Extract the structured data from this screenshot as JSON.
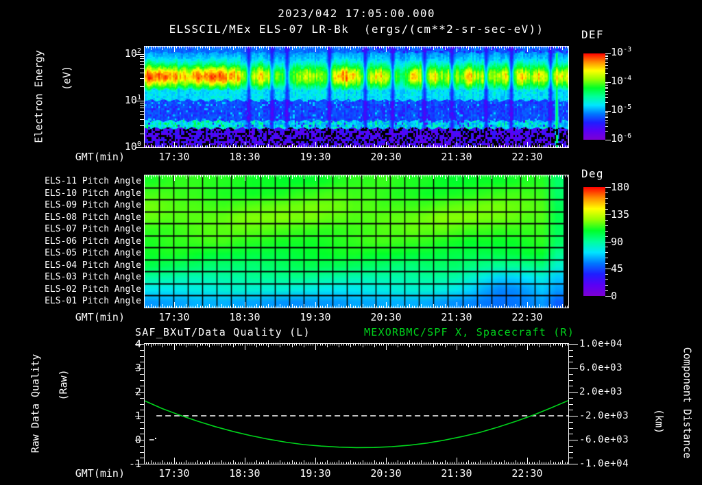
{
  "colors": {
    "background": "#000000",
    "foreground": "#ffffff",
    "series_green": "#00d41c",
    "colormap_stops_bottom_to_top": [
      "#7d00d2",
      "#5a00f5",
      "#1e1eff",
      "#0078ff",
      "#00e6ff",
      "#00ff9b",
      "#00ff28",
      "#96ff00",
      "#ffff00",
      "#ff8c00",
      "#ff0000"
    ]
  },
  "header": {
    "title": "2023/042 17:05:00.000",
    "subtitle": "ELSSCIL/MEx ELS-07 LR-Bk  (ergs/(cm**2-sr-sec-eV))"
  },
  "time_axis": {
    "label": "GMT(min)",
    "start_time": "17:05",
    "end_time": "23:05",
    "total_minutes": 360,
    "tick_labels": [
      "17:30",
      "18:30",
      "19:30",
      "20:30",
      "21:30",
      "22:30"
    ],
    "tick_minutes": [
      25,
      85,
      145,
      205,
      265,
      325
    ]
  },
  "spectrogram_panel": {
    "ylabel_line1": "Electron Energy",
    "ylabel_line2": "(eV)",
    "y_ticks": [
      {
        "base": "10",
        "exp": "0"
      },
      {
        "base": "10",
        "exp": "1"
      },
      {
        "base": "10",
        "exp": "2"
      }
    ],
    "colorbar": {
      "title": "DEF",
      "tick_labels": [
        {
          "base": "10",
          "exp": "-3"
        },
        {
          "base": "10",
          "exp": "-4"
        },
        {
          "base": "10",
          "exp": "-5"
        },
        {
          "base": "10",
          "exp": "-6"
        }
      ]
    }
  },
  "pitch_panel": {
    "row_labels": [
      "ELS-11 Pitch Angle",
      "ELS-10 Pitch Angle",
      "ELS-09 Pitch Angle",
      "ELS-08 Pitch Angle",
      "ELS-07 Pitch Angle",
      "ELS-06 Pitch Angle",
      "ELS-05 Pitch Angle",
      "ELS-04 Pitch Angle",
      "ELS-03 Pitch Angle",
      "ELS-02 Pitch Angle",
      "ELS-01 Pitch Angle"
    ],
    "colorbar": {
      "title": "Deg",
      "tick_labels": [
        "180",
        "135",
        "90",
        "45",
        "0"
      ]
    }
  },
  "bottom_panel": {
    "left_title": "SAF_BXuT/Data Quality (L)",
    "right_title": "MEXORBMC/SPF X, Spacecraft (R)",
    "left_axis": {
      "label_line1": "Raw Data Quality",
      "label_line2": "(Raw)",
      "tick_labels": [
        "4",
        "3",
        "2",
        "1",
        "0",
        "-1"
      ]
    },
    "right_axis": {
      "label_line1": "Component Distance",
      "label_line2": "(km)",
      "tick_labels": [
        "1.0e+04",
        "6.0e+03",
        "2.0e+03",
        "-2.0e+03",
        "-6.0e+03",
        "-1.0e+04"
      ]
    }
  },
  "chart_data": [
    {
      "type": "heatmap",
      "name": "electron-energy-spectrogram",
      "title": "ELSSCIL/MEx ELS-07 LR-Bk",
      "units": "ergs/(cm**2-sr-sec-eV)",
      "x_range": [
        "17:05",
        "23:05"
      ],
      "x_tick_labels": [
        "17:30",
        "18:30",
        "19:30",
        "20:30",
        "21:30",
        "22:30"
      ],
      "y_scale": "log",
      "y_range_ev": [
        1,
        145
      ],
      "y_tick_labels": [
        "10^0",
        "10^1",
        "10^2"
      ],
      "colorbar_title": "DEF",
      "color_scale_log10_range": [
        -6,
        -3
      ],
      "colorbar_tick_labels": [
        "10^-3",
        "10^-4",
        "10^-5",
        "10^-6"
      ],
      "energy_bands": [
        {
          "energy_ev": [
            1,
            2.5
          ],
          "log10_def": -5.8,
          "desc": "noise floor, dark violet with black speckle"
        },
        {
          "energy_ev": [
            2.5,
            3.6
          ],
          "log10_def": -4.7,
          "desc": "streaky cyan band, brighter before 18:30"
        },
        {
          "energy_ev": [
            3.6,
            10
          ],
          "log10_def": -5.2,
          "desc": "blue band with dark patches"
        },
        {
          "energy_ev": [
            10,
            17
          ],
          "log10_def": -4.65,
          "desc": "cyan transition band"
        },
        {
          "energy_ev": [
            17,
            60
          ],
          "log10_def": -3.5,
          "desc": "bright photoelectron band: yellow-green before 18:30, broken 18:30-20:30, striped green 20:30-22:40"
        },
        {
          "energy_ev": [
            60,
            105
          ],
          "log10_def": -4.4,
          "desc": "green-cyan shoulder"
        },
        {
          "energy_ev": [
            105,
            145
          ],
          "log10_def": -5.1,
          "desc": "blue top band, darker after 19:40"
        }
      ],
      "features": {
        "dropout_time_fracs": [
          0.245,
          0.3,
          0.335,
          0.435,
          0.52,
          0.585,
          0.66,
          0.725,
          0.805,
          0.865,
          0.958
        ],
        "bright_streak_frac": 0.972
      }
    },
    {
      "type": "heatmap",
      "name": "pitch-angle-panel",
      "deg_range": [
        0,
        180
      ],
      "colorbar_title": "Deg",
      "colorbar_tick_labels": [
        180,
        135,
        90,
        45,
        0
      ],
      "n_time_columns": 29,
      "rows": [
        {
          "label": "ELS-11 Pitch Angle",
          "mean_deg": 118
        },
        {
          "label": "ELS-10 Pitch Angle",
          "mean_deg": 120
        },
        {
          "label": "ELS-09 Pitch Angle",
          "mean_deg": 126
        },
        {
          "label": "ELS-08 Pitch Angle",
          "mean_deg": 128
        },
        {
          "label": "ELS-07 Pitch Angle",
          "mean_deg": 124
        },
        {
          "label": "ELS-06 Pitch Angle",
          "mean_deg": 120
        },
        {
          "label": "ELS-05 Pitch Angle",
          "mean_deg": 114
        },
        {
          "label": "ELS-04 Pitch Angle",
          "mean_deg": 106
        },
        {
          "label": "ELS-03 Pitch Angle",
          "mean_deg": 96
        },
        {
          "label": "ELS-02 Pitch Angle",
          "mean_deg": 84
        },
        {
          "label": "ELS-01 Pitch Angle",
          "mean_deg": 66
        }
      ],
      "anomaly": {
        "time": "21:15-22:05",
        "center_col": 24.4,
        "row_depth_deg": [
          0,
          0,
          0,
          0,
          0,
          -2,
          -5,
          -12,
          -22,
          -22,
          -8
        ]
      },
      "right_edge_deg_shift": -16
    },
    {
      "type": "line",
      "name": "quality-and-spacecraft-x",
      "left_ylim": [
        -1,
        4
      ],
      "right_ylim": [
        -10000,
        10000
      ],
      "left_tick_values": [
        4,
        3,
        2,
        1,
        0,
        -1
      ],
      "right_tick_values": [
        10000,
        6000,
        2000,
        -2000,
        -6000,
        -10000
      ],
      "series": [
        {
          "name": "SAF_BXuT/Data Quality (L)",
          "axis": "left",
          "color": "#ffffff",
          "style": "dashed",
          "segments_min_value": [
            [
              [
                4,
                0
              ],
              [
                8,
                0
              ]
            ],
            [
              [
                10,
                1
              ],
              [
                360,
                1
              ]
            ]
          ]
        },
        {
          "name": "MEXORBMC/SPF X, Spacecraft (R)",
          "axis": "right",
          "color": "#00d41c",
          "style": "solid",
          "points_min_km": [
            [
              0,
              500
            ],
            [
              15,
              -800
            ],
            [
              30,
              -1900
            ],
            [
              45,
              -2900
            ],
            [
              60,
              -3800
            ],
            [
              75,
              -4600
            ],
            [
              90,
              -5300
            ],
            [
              105,
              -5900
            ],
            [
              120,
              -6400
            ],
            [
              135,
              -6800
            ],
            [
              150,
              -7050
            ],
            [
              165,
              -7220
            ],
            [
              180,
              -7300
            ],
            [
              195,
              -7280
            ],
            [
              210,
              -7150
            ],
            [
              225,
              -6900
            ],
            [
              240,
              -6550
            ],
            [
              255,
              -6050
            ],
            [
              270,
              -5450
            ],
            [
              285,
              -4750
            ],
            [
              300,
              -3900
            ],
            [
              315,
              -2950
            ],
            [
              330,
              -1900
            ],
            [
              345,
              -700
            ],
            [
              360,
              550
            ]
          ]
        }
      ]
    }
  ]
}
